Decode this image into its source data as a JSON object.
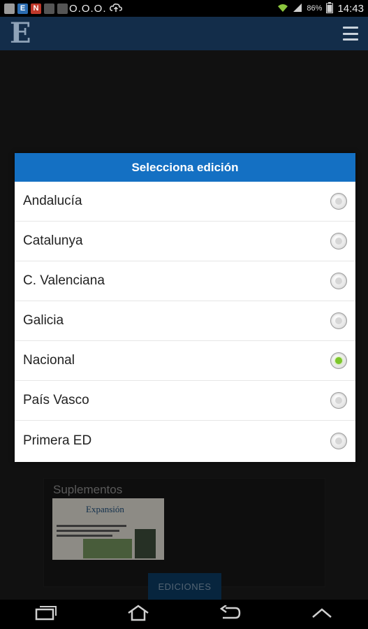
{
  "status_bar": {
    "notification_icons": [
      {
        "name": "image-icon",
        "color": "#9a9a9a",
        "glyph": ""
      },
      {
        "name": "el-mundo-e-icon",
        "color": "#2b6cb0",
        "glyph": "E"
      },
      {
        "name": "n-app-icon",
        "color": "#c0392b",
        "glyph": "N"
      },
      {
        "name": "globe-icon",
        "color": "#555555",
        "glyph": ""
      },
      {
        "name": "globe-icon-2",
        "color": "#555555",
        "glyph": ""
      }
    ],
    "dots": "O.O.O.",
    "battery_percent": "86%",
    "time": "14:43"
  },
  "app_bar": {
    "logo_letter": "E"
  },
  "dialog": {
    "title": "Selecciona edición",
    "options": [
      {
        "label": "Andalucía",
        "selected": false
      },
      {
        "label": "Catalunya",
        "selected": false
      },
      {
        "label": "C. Valenciana",
        "selected": false
      },
      {
        "label": "Galicia",
        "selected": false
      },
      {
        "label": "Nacional",
        "selected": true
      },
      {
        "label": "País Vasco",
        "selected": false
      },
      {
        "label": "Primera ED",
        "selected": false
      }
    ]
  },
  "background": {
    "supplements_title": "Suplementos",
    "thumbnail_masthead": "Expansión",
    "ediciones_label": "EDICIONES"
  },
  "colors": {
    "accent": "#1470c3",
    "app_bar": "#132d4a",
    "selected_radio": "#7cc62a"
  }
}
